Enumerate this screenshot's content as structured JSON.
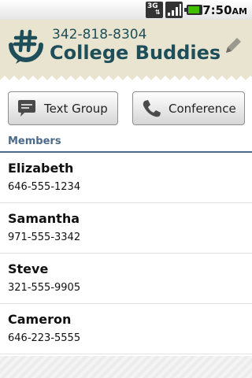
{
  "status_bar": {
    "network": "3G",
    "time": "7:50",
    "ampm": "AM",
    "battery_color": "#3fbf00"
  },
  "header": {
    "phone_number": "342-818-8304",
    "group_name": "College Buddies",
    "logo_icon": "hashtag-speech-icon",
    "edit_icon": "pencil-icon",
    "text_color": "#1e4e5a",
    "background": "#e8e4cf"
  },
  "actions": {
    "text_group_label": "Text Group",
    "text_group_icon": "chat-bubble-icon",
    "conference_label": "Conference",
    "conference_icon": "phone-handset-icon"
  },
  "members_section": {
    "title": "Members",
    "accent": "#4c6a8a",
    "items": [
      {
        "name": "Elizabeth",
        "phone": "646-555-1234"
      },
      {
        "name": "Samantha",
        "phone": "971-555-3342"
      },
      {
        "name": "Steve",
        "phone": "321-555-9905"
      },
      {
        "name": "Cameron",
        "phone": "646-223-5555"
      }
    ]
  }
}
